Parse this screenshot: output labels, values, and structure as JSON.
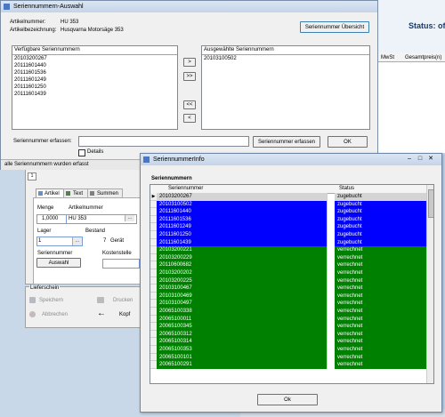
{
  "background_app": {
    "status_label": "Status: of",
    "vat_column": "MwSt",
    "total_price_column": "Gesamtpreis(n)",
    "tabs": [
      {
        "label": "Artikel"
      },
      {
        "label": "Text"
      },
      {
        "label": "Summen"
      }
    ],
    "labels": {
      "quantity": "Menge",
      "article_number": "Artikelnummer",
      "warehouse": "Lager",
      "stock": "Bestand",
      "device_prefix": "Gerät",
      "serial_number": "Seriennummer",
      "cost_center": "Kostenstelle"
    },
    "values": {
      "quantity": "1,0000",
      "article_number": "HU 353",
      "warehouse": "1",
      "stock": "7"
    },
    "buttons": {
      "selection": "Auswahl",
      "save": "Speichern",
      "print": "Drucken",
      "cancel": "Abbrechen",
      "head": "Kopf"
    },
    "delivery_group": "Lieferschein",
    "small_box": "1"
  },
  "serial_dialog": {
    "title": "Seriennummern-Auswahl",
    "article_number_label": "Artikelnummer:",
    "article_number_value": "HU 353",
    "article_desc_label": "Artikelbezeichnung:",
    "article_desc_value": "Husqvarna Motorsäge 353",
    "overview_button": "Seriennummer Übersicht",
    "available_header": "Verfügbare Seriennummern",
    "available": [
      "20103200267",
      "20111601440",
      "20111601536",
      "20111601249",
      "20111601250",
      "20111601439"
    ],
    "selected_header": "Ausgewählte Seriennummern",
    "selected": [
      "20103100502"
    ],
    "move_buttons": [
      ">",
      ">>",
      "<<",
      "<"
    ],
    "enter_label": "Seriennummer erfassen:",
    "details_label": "Details",
    "enter_button": "Seriennummer erfassen",
    "ok_button": "OK",
    "status_text": "alle Seriennummern wurden erfasst"
  },
  "info_dialog": {
    "title": "SeriennummerInfo",
    "group_title": "Seriennummern",
    "columns": [
      "Seriennummer",
      "Status"
    ],
    "rows": [
      {
        "serial": "20103200267",
        "status": "zugebucht",
        "color": "gray"
      },
      {
        "serial": "20103100502",
        "status": "zugebucht",
        "color": "blue"
      },
      {
        "serial": "20111601440",
        "status": "zugebucht",
        "color": "blue"
      },
      {
        "serial": "20111601536",
        "status": "zugebucht",
        "color": "blue"
      },
      {
        "serial": "20111601249",
        "status": "zugebucht",
        "color": "blue"
      },
      {
        "serial": "20111601250",
        "status": "zugebucht",
        "color": "blue"
      },
      {
        "serial": "20111601439",
        "status": "zugebucht",
        "color": "blue"
      },
      {
        "serial": "20103200221",
        "status": "verrechnet",
        "color": "green"
      },
      {
        "serial": "20103200229",
        "status": "verrechnet",
        "color": "green"
      },
      {
        "serial": "20110600682",
        "status": "verrechnet",
        "color": "green"
      },
      {
        "serial": "20103200202",
        "status": "verrechnet",
        "color": "green"
      },
      {
        "serial": "20103200225",
        "status": "verrechnet",
        "color": "green"
      },
      {
        "serial": "20103100467",
        "status": "verrechnet",
        "color": "green"
      },
      {
        "serial": "20103100469",
        "status": "verrechnet",
        "color": "green"
      },
      {
        "serial": "20103100497",
        "status": "verrechnet",
        "color": "green"
      },
      {
        "serial": "20065100338",
        "status": "verrechnet",
        "color": "green"
      },
      {
        "serial": "20065100011",
        "status": "verrechnet",
        "color": "green"
      },
      {
        "serial": "20065100345",
        "status": "verrechnet",
        "color": "green"
      },
      {
        "serial": "20065100312",
        "status": "verrechnet",
        "color": "green"
      },
      {
        "serial": "20065100314",
        "status": "verrechnet",
        "color": "green"
      },
      {
        "serial": "20065100353",
        "status": "verrechnet",
        "color": "green"
      },
      {
        "serial": "20065100101",
        "status": "verrechnet",
        "color": "green"
      },
      {
        "serial": "20065100291",
        "status": "verrechnet",
        "color": "green"
      }
    ],
    "ok_button": "Ok"
  },
  "colors": {
    "blue_row": "#0000ff",
    "green_row": "#008000",
    "gray_row": "#d4d4d4",
    "title_bar": "#d6e4f3"
  }
}
